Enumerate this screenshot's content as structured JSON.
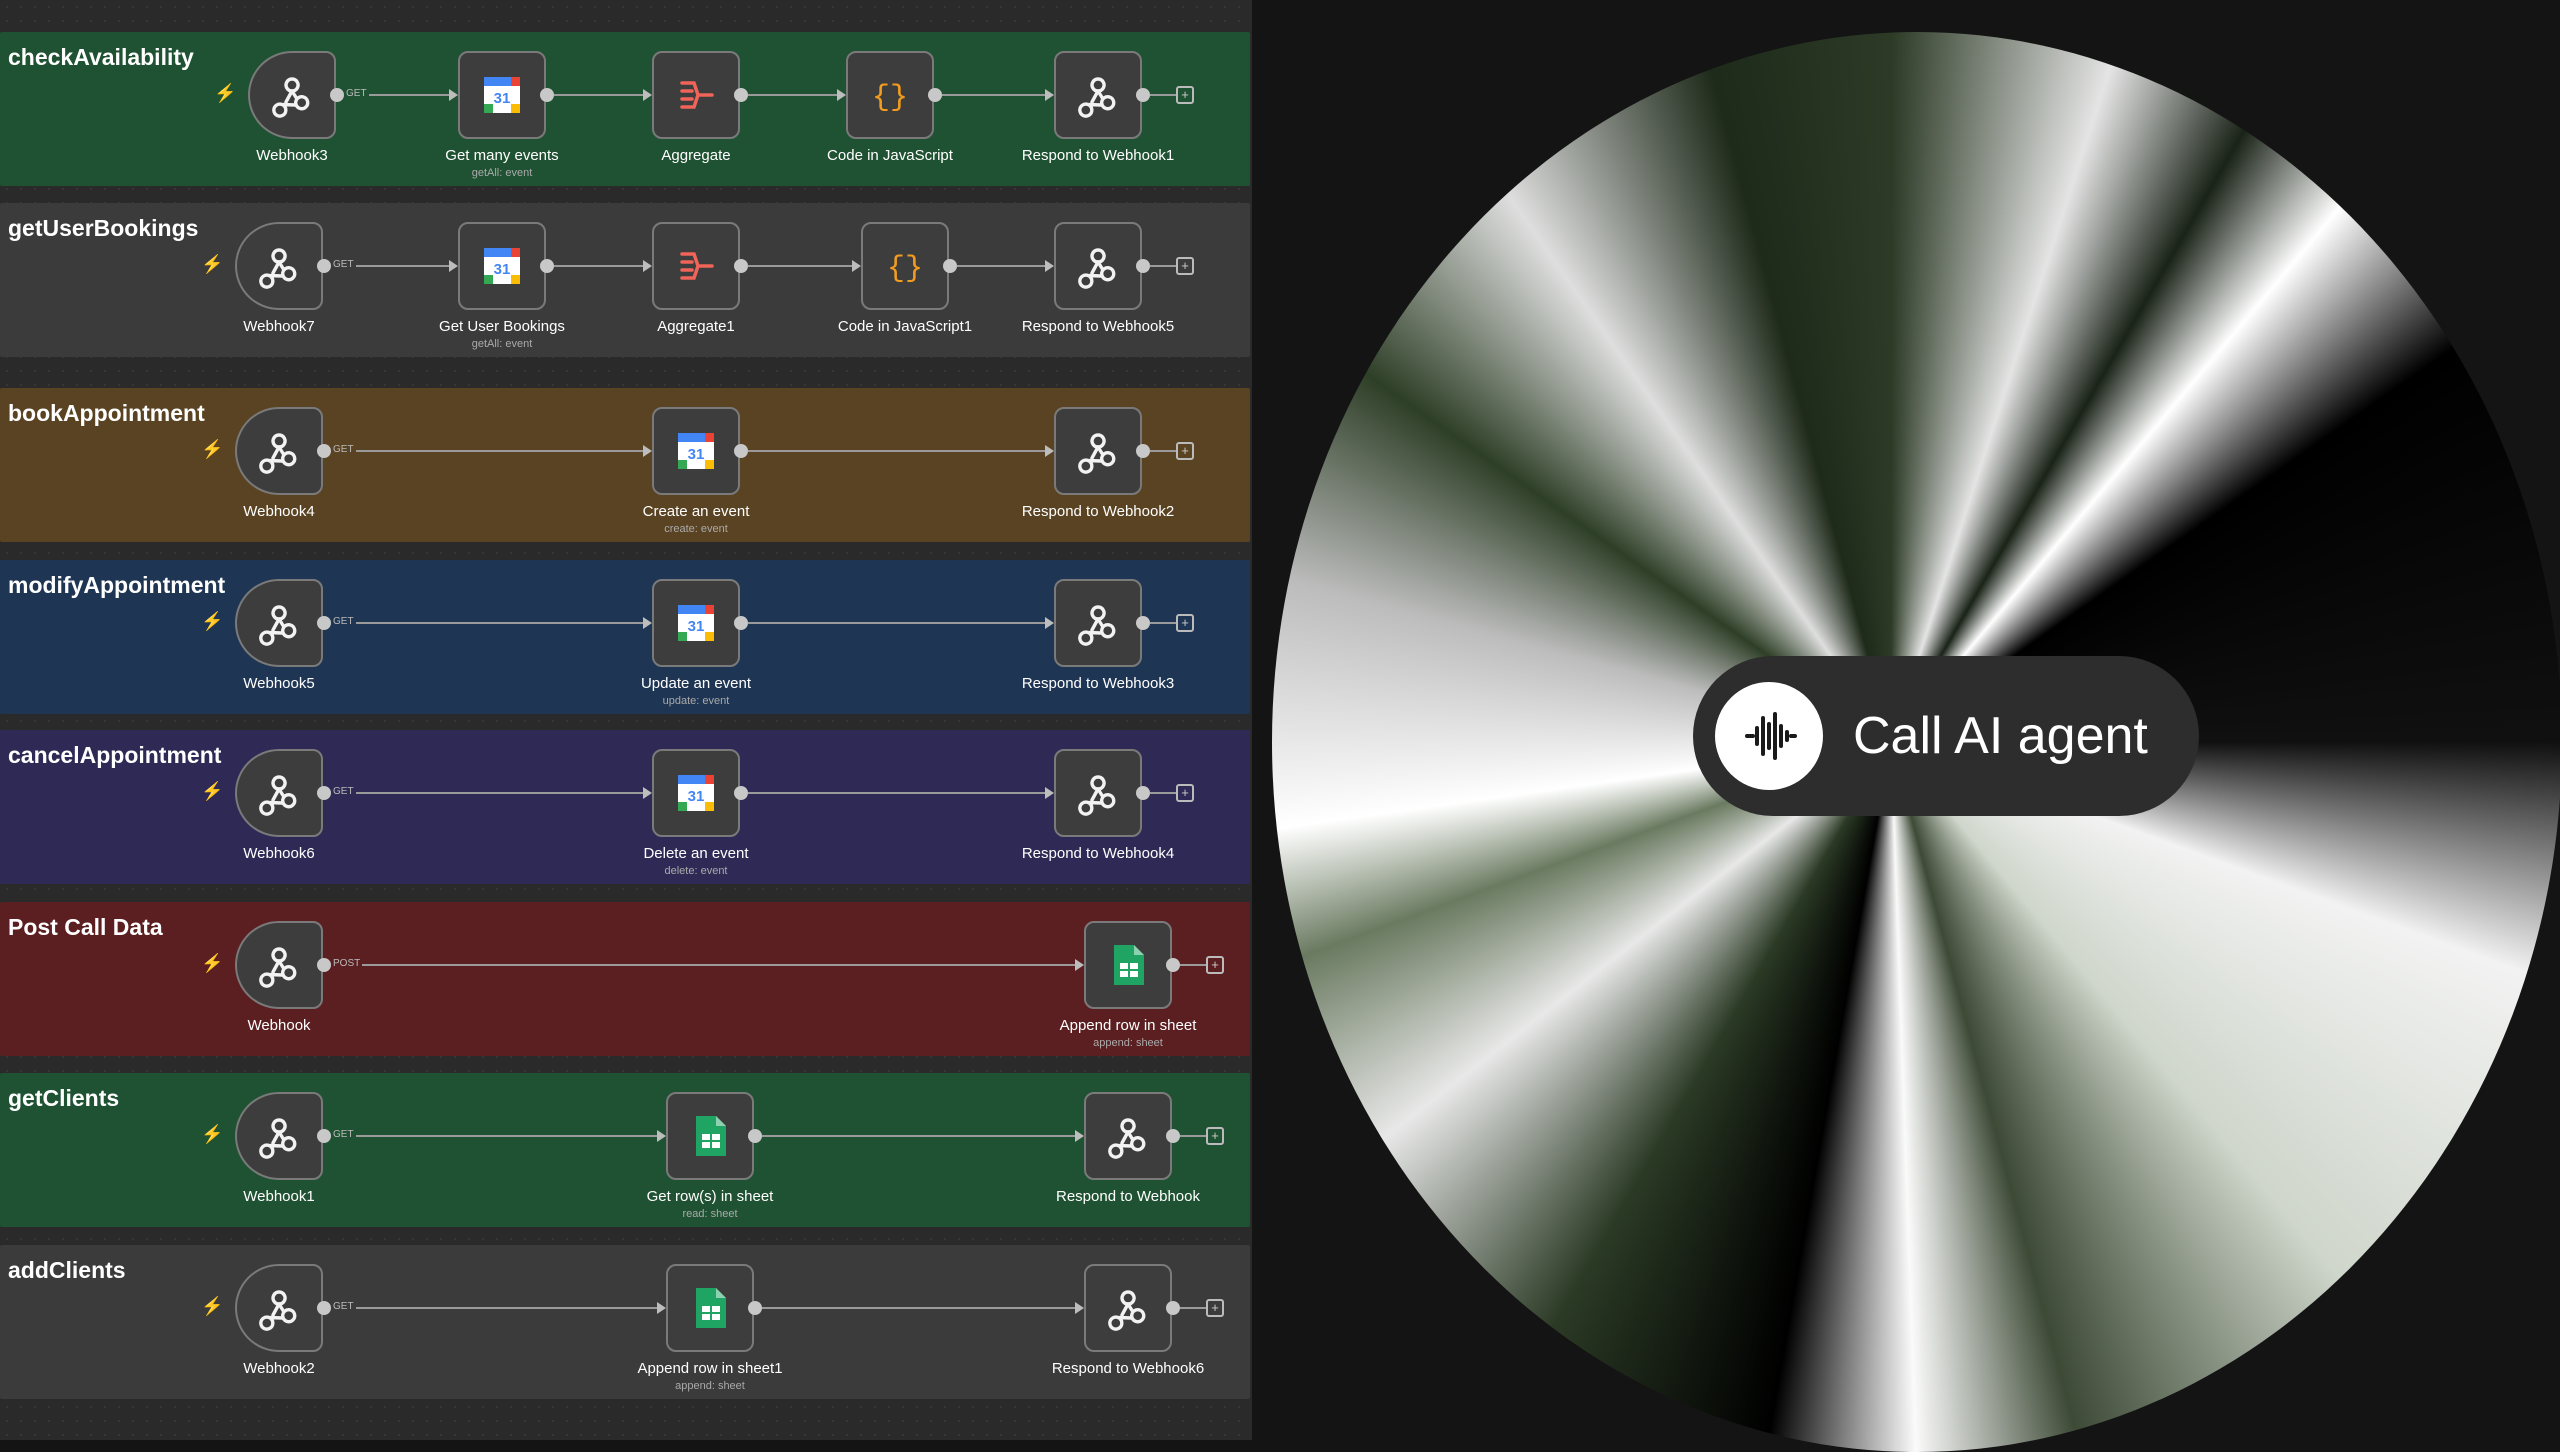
{
  "workflows": [
    {
      "title": "checkAvailability",
      "color": "#1f5232",
      "nodes": [
        {
          "label": "Webhook3",
          "sub": "",
          "icon": "webhook-icon"
        },
        {
          "label": "Get many events",
          "sub": "getAll: event",
          "icon": "calendar-icon"
        },
        {
          "label": "Aggregate",
          "sub": "",
          "icon": "aggregate-icon"
        },
        {
          "label": "Code in JavaScript",
          "sub": "",
          "icon": "code-icon"
        },
        {
          "label": "Respond to Webhook1",
          "sub": "",
          "icon": "webhook-icon"
        }
      ],
      "method": "GET"
    },
    {
      "title": "getUserBookings",
      "color": "#3b3b3b",
      "nodes": [
        {
          "label": "Webhook7",
          "sub": "",
          "icon": "webhook-icon"
        },
        {
          "label": "Get User Bookings",
          "sub": "getAll: event",
          "icon": "calendar-icon"
        },
        {
          "label": "Aggregate1",
          "sub": "",
          "icon": "aggregate-icon"
        },
        {
          "label": "Code in JavaScript1",
          "sub": "",
          "icon": "code-icon"
        },
        {
          "label": "Respond to Webhook5",
          "sub": "",
          "icon": "webhook-icon"
        }
      ],
      "method": "GET"
    },
    {
      "title": "bookAppointment",
      "color": "#5a4322",
      "nodes": [
        {
          "label": "Webhook4",
          "sub": "",
          "icon": "webhook-icon"
        },
        {
          "label": "Create an event",
          "sub": "create: event",
          "icon": "calendar-icon"
        },
        {
          "label": "Respond to Webhook2",
          "sub": "",
          "icon": "webhook-icon"
        }
      ],
      "method": "GET"
    },
    {
      "title": "modifyAppointment",
      "color": "#1e3553",
      "nodes": [
        {
          "label": "Webhook5",
          "sub": "",
          "icon": "webhook-icon"
        },
        {
          "label": "Update an event",
          "sub": "update: event",
          "icon": "calendar-icon"
        },
        {
          "label": "Respond to Webhook3",
          "sub": "",
          "icon": "webhook-icon"
        }
      ],
      "method": "GET"
    },
    {
      "title": "cancelAppointment",
      "color": "#2f2a55",
      "nodes": [
        {
          "label": "Webhook6",
          "sub": "",
          "icon": "webhook-icon"
        },
        {
          "label": "Delete an event",
          "sub": "delete: event",
          "icon": "calendar-icon"
        },
        {
          "label": "Respond to Webhook4",
          "sub": "",
          "icon": "webhook-icon"
        }
      ],
      "method": "GET"
    },
    {
      "title": "Post Call Data",
      "color": "#5b1f21",
      "nodes": [
        {
          "label": "Webhook",
          "sub": "",
          "icon": "webhook-icon"
        },
        {
          "label": "Append row in sheet",
          "sub": "append: sheet",
          "icon": "sheets-icon"
        }
      ],
      "method": "POST"
    },
    {
      "title": "getClients",
      "color": "#1f5232",
      "nodes": [
        {
          "label": "Webhook1",
          "sub": "",
          "icon": "webhook-icon"
        },
        {
          "label": "Get row(s) in sheet",
          "sub": "read: sheet",
          "icon": "sheets-icon"
        },
        {
          "label": "Respond to Webhook",
          "sub": "",
          "icon": "webhook-icon"
        }
      ],
      "method": "GET"
    },
    {
      "title": "addClients",
      "color": "#3b3b3b",
      "nodes": [
        {
          "label": "Webhook2",
          "sub": "",
          "icon": "webhook-icon"
        },
        {
          "label": "Append row in sheet1",
          "sub": "append: sheet",
          "icon": "sheets-icon"
        },
        {
          "label": "Respond to Webhook6",
          "sub": "",
          "icon": "webhook-icon"
        }
      ],
      "method": "GET"
    }
  ],
  "agent": {
    "label": "Call AI agent",
    "icon": "waveform-icon"
  }
}
